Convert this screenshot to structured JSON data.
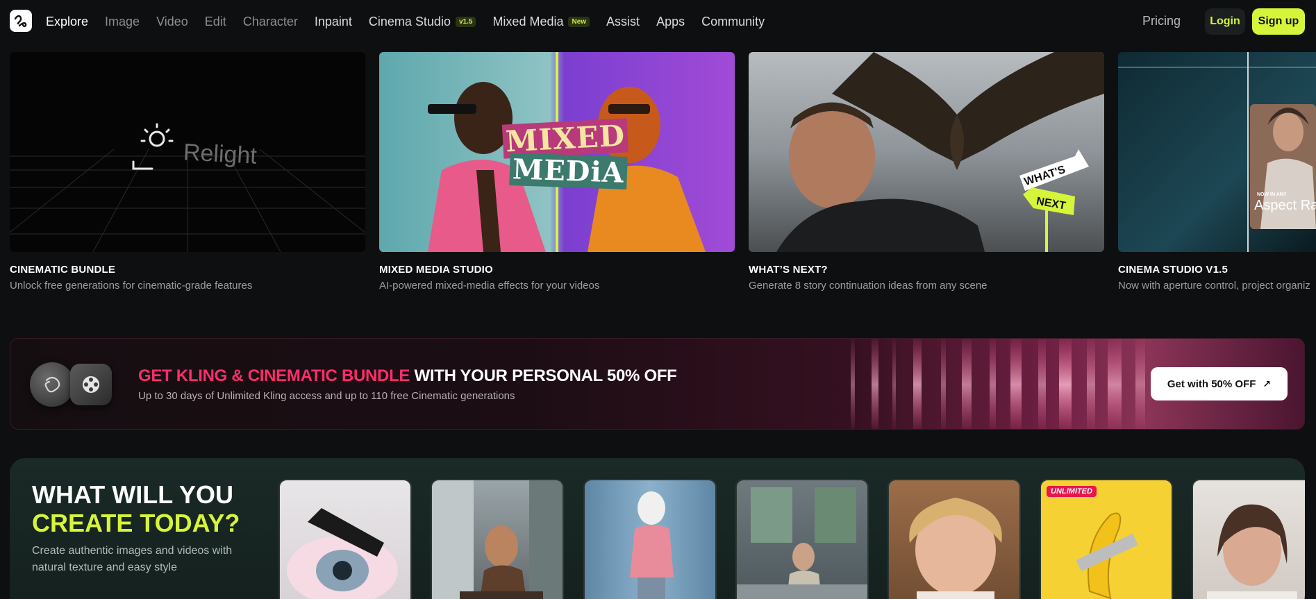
{
  "nav": {
    "links": [
      {
        "label": "Explore",
        "state": "active"
      },
      {
        "label": "Image",
        "state": "muted"
      },
      {
        "label": "Video",
        "state": "muted"
      },
      {
        "label": "Edit",
        "state": "muted"
      },
      {
        "label": "Character",
        "state": "muted"
      },
      {
        "label": "Inpaint",
        "state": "bright"
      },
      {
        "label": "Cinema Studio",
        "state": "bright",
        "tag": "v1.5"
      },
      {
        "label": "Mixed Media",
        "state": "bright",
        "tag": "New"
      },
      {
        "label": "Assist",
        "state": "bright"
      },
      {
        "label": "Apps",
        "state": "bright"
      },
      {
        "label": "Community",
        "state": "bright"
      }
    ],
    "pricing": "Pricing",
    "login": "Login",
    "signup": "Sign up"
  },
  "cards": [
    {
      "title": "CINEMATIC BUNDLE",
      "subtitle": "Unlock free generations for cinematic-grade features",
      "image_text": "Relight"
    },
    {
      "title": "MIXED MEDIA STUDIO",
      "subtitle": "AI-powered mixed-media effects for your videos",
      "image_text_1": "MIXED",
      "image_text_2": "MEDiA"
    },
    {
      "title": "WHAT’S NEXT?",
      "subtitle": "Generate 8 story continuation ideas from any scene",
      "image_text_1": "WHAT'S",
      "image_text_2": "NEXT"
    },
    {
      "title": "CINEMA STUDIO V1.5",
      "subtitle": "Now with aperture control, project organiz",
      "image_text_1": "NOW IN ANY",
      "image_text_2": "Aspect Ra"
    }
  ],
  "banner": {
    "title_highlight": "GET KLING & CINEMATIC BUNDLE",
    "title_rest": " WITH YOUR PERSONAL 50% OFF",
    "subtitle": "Up to 30 days of Unlimited Kling access and up to 110 free Cinematic generations",
    "button": "Get with 50% OFF"
  },
  "create": {
    "title_line1": "WHAT WILL YOU",
    "title_line2": "CREATE TODAY?",
    "subtitle": "Create authentic images and videos with natural texture and easy style",
    "badge": "UNLIMITED"
  },
  "colors": {
    "accent": "#d6f53a",
    "pink": "#ff2d6a",
    "background": "#0d0f10"
  }
}
